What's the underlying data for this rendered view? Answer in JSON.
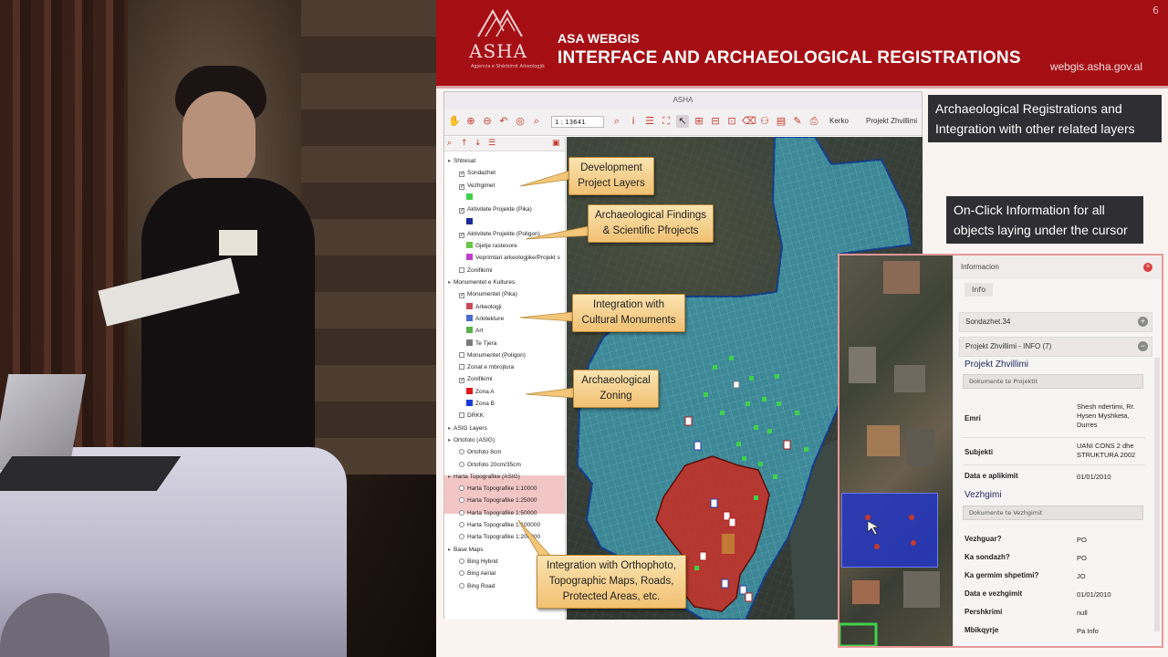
{
  "slide": {
    "number": "6",
    "logo_text": "ASHA",
    "logo_sub": "Agjencia e Shërbimit Arkeologjik",
    "subtitle": "ASA WEBGIS",
    "title": "INTERFACE AND ARCHAEOLOGICAL REGISTRATIONS",
    "url": "webgis.asha.gov.al",
    "label_registrations": "Archaeological Registrations and Integration with other related layers",
    "label_onclick": "On-Click Information for all objects laying under the cursor"
  },
  "app": {
    "window_title": "ASHA",
    "scale_value": "1 : 13641",
    "search_label": "Kerko",
    "project_label": "Projekt Zhvillimi"
  },
  "tree": {
    "rows": [
      {
        "label": "Shtresat",
        "kind": "group"
      },
      {
        "label": "Sondazhet",
        "kind": "check",
        "checked": "✓"
      },
      {
        "label": "Vezhgimet",
        "kind": "check",
        "checked": "✓"
      },
      {
        "label": "",
        "kind": "swatch",
        "color": "#3fd14a"
      },
      {
        "label": "Aktivitete Projekte (Pika)",
        "kind": "check",
        "checked": "✓"
      },
      {
        "label": "",
        "kind": "swatch",
        "color": "#1b2a9a"
      },
      {
        "label": "Aktivitete Projekte (Poligon)",
        "kind": "check",
        "checked": "✓"
      },
      {
        "label": "Gjetje rastesore",
        "kind": "swatch",
        "color": "#68c84a"
      },
      {
        "label": "Veprimtari arkeologjike/Projekt s",
        "kind": "swatch",
        "color": "#c23ad0"
      },
      {
        "label": "Zonifikimi",
        "kind": "check",
        "checked": ""
      },
      {
        "label": "Monumentet e Kultures",
        "kind": "group"
      },
      {
        "label": "Monumentet (Pika)",
        "kind": "check",
        "checked": "✓"
      },
      {
        "label": "Arkeologji",
        "kind": "swatch",
        "color": "#c84a5a"
      },
      {
        "label": "Arkitekture",
        "kind": "swatch",
        "color": "#4a6ad0"
      },
      {
        "label": "Art",
        "kind": "swatch",
        "color": "#5ab04a"
      },
      {
        "label": "Te Tjera",
        "kind": "swatch",
        "color": "#7a7a7a"
      },
      {
        "label": "Monumentet (Poligon)",
        "kind": "check",
        "checked": ""
      },
      {
        "label": "Zonat e mbrojtura",
        "kind": "check",
        "checked": ""
      },
      {
        "label": "Zonifikimi",
        "kind": "check",
        "checked": "✓"
      },
      {
        "label": "Zona A",
        "kind": "swatch",
        "color": "#e01818"
      },
      {
        "label": "Zona B",
        "kind": "swatch",
        "color": "#1a3ad8"
      },
      {
        "label": "DRKK",
        "kind": "check",
        "checked": ""
      },
      {
        "label": "ASIG Layers",
        "kind": "group"
      },
      {
        "label": "Ortofoto (ASIG)",
        "kind": "group"
      },
      {
        "label": "Ortofoto 8cm",
        "kind": "radio"
      },
      {
        "label": "Ortofoto 20cm/35cm",
        "kind": "radio"
      },
      {
        "label": "Harta Topografike (ASIG)",
        "kind": "group"
      },
      {
        "label": "Harta Topografike 1:10000",
        "kind": "radio"
      },
      {
        "label": "Harta Topografike 1:25000",
        "kind": "radio"
      },
      {
        "label": "Harta Topografike 1:50000",
        "kind": "radio"
      },
      {
        "label": "Harta Topografike 1:100000",
        "kind": "radio"
      },
      {
        "label": "Harta Topografike 1:200000",
        "kind": "radio"
      },
      {
        "label": "Base Maps",
        "kind": "group"
      },
      {
        "label": "Bing Hybrid",
        "kind": "radio"
      },
      {
        "label": "Bing Aerial",
        "kind": "radio"
      },
      {
        "label": "Bing Road",
        "kind": "radio"
      }
    ]
  },
  "callouts": {
    "development": "Development Project Layers",
    "findings": "Archaeological Findings & Scientific Pfrojects",
    "cultural": "Integration with Cultural Monuments",
    "zoning": "Archaeological Zoning",
    "orthophoto": "Integration with Orthophoto, Topographic Maps, Roads, Protected Areas, etc."
  },
  "info": {
    "header": "Informacion",
    "tab": "Info",
    "acc1": "Sondazhet.34",
    "acc2": "Projekt Zhvillimi - INFO (7)",
    "sec1_title": "Projekt Zhvillimi",
    "sec1_doc": "Dokumente te Projektit",
    "emri_key": "Emri",
    "emri_val": "Shesh ndertimi, Rr. Hysen Myshketa, Durres",
    "subjekti_key": "Subjekti",
    "subjekti_val": "UANI CONS 2 dhe STRUKTURA 2002",
    "data_apl_key": "Data e aplikimit",
    "data_apl_val": "01/01/2010",
    "sec2_title": "Vezhgimi",
    "sec2_doc": "Dokumente te Vezhgimit",
    "vezhguar_key": "Vezhguar?",
    "vezhguar_val": "PO",
    "sondazh_key": "Ka sondazh?",
    "sondazh_val": "PO",
    "germim_key": "Ka germim shpetimi?",
    "germim_val": "JO",
    "data_vezh_key": "Data e vezhgimit",
    "data_vezh_val": "01/01/2010",
    "pershkrimi_key": "Pershkrimi",
    "pershkrimi_val": "null",
    "mbikqyrje_key": "Mbikqyrje",
    "mbikqyrje_val": "Pa Info"
  }
}
